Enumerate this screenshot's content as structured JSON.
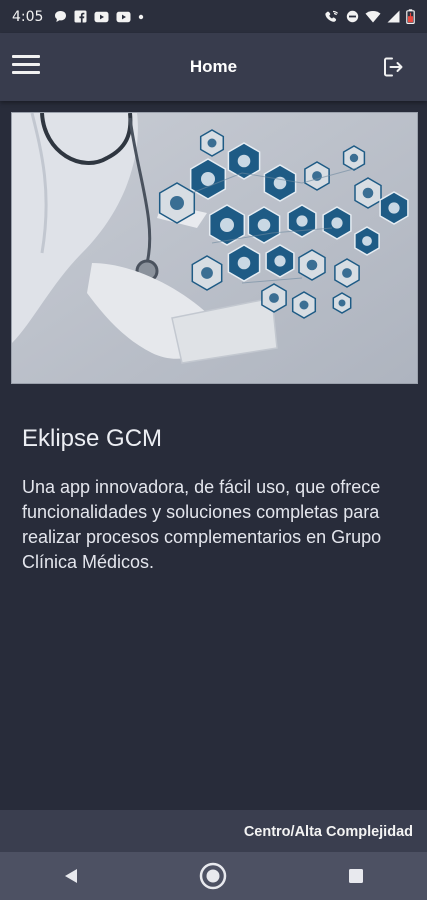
{
  "status_bar": {
    "time": "4:05",
    "left_icons": [
      "chat-bubble-icon",
      "facebook-icon",
      "youtube-icon",
      "youtube-icon",
      "dot-icon"
    ],
    "right_icons": [
      "wifi-call-icon",
      "do-not-disturb-icon",
      "wifi-icon",
      "signal-icon",
      "battery-low-icon"
    ]
  },
  "app_bar": {
    "title": "Home",
    "menu_icon": "hamburger-menu-icon",
    "logout_icon": "logout-icon"
  },
  "hero": {
    "image": "doctor-medical-hexagon-icons"
  },
  "main": {
    "title": "Eklipse GCM",
    "description": "Una app innovadora, de fácil uso, que ofrece funcionalidades y soluciones completas para realizar procesos complementarios en Grupo Clínica Médicos."
  },
  "footer": {
    "label": "Centro/Alta Complejidad"
  },
  "colors": {
    "background": "#282c3a",
    "app_bar": "#383c4d",
    "footer": "#3a3e4f",
    "nav_bar": "#4d5163",
    "hexagon_blue": "#1e5b85"
  },
  "nav": {
    "buttons": [
      "back-icon",
      "home-icon",
      "recents-icon"
    ]
  }
}
